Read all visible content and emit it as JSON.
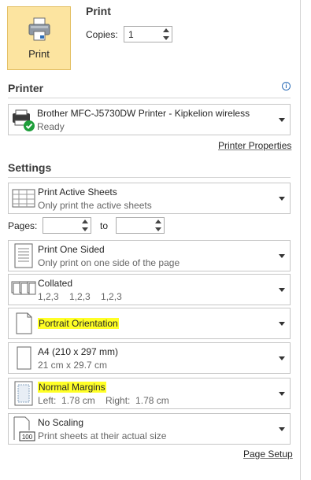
{
  "print_button": {
    "label": "Print"
  },
  "print_section": {
    "heading": "Print",
    "copies_label": "Copies:",
    "copies_value": "1"
  },
  "printer": {
    "heading": "Printer",
    "name": "Brother MFC-J5730DW Printer - Kipkelion wireless",
    "status": "Ready",
    "properties_link": "Printer Properties"
  },
  "settings": {
    "heading": "Settings",
    "pages_label": "Pages:",
    "pages_from": "",
    "to_label": "to",
    "pages_to": "",
    "options": [
      {
        "title": "Print Active Sheets",
        "subtitle": "Only print the active sheets",
        "icon": "sheets-icon"
      },
      {
        "title": "Print One Sided",
        "subtitle": "Only print on one side of the page",
        "icon": "one-sided-icon"
      },
      {
        "title": "Collated",
        "subtitle": "1,2,3    1,2,3    1,2,3",
        "icon": "collated-icon"
      },
      {
        "title": "Portrait Orientation",
        "subtitle": "",
        "icon": "portrait-icon",
        "highlighted": true
      },
      {
        "title": "A4 (210 x 297 mm)",
        "subtitle": "21 cm x 29.7 cm",
        "icon": "paper-size-icon"
      },
      {
        "title": "Normal Margins",
        "subtitle": "Left:  1.78 cm    Right:  1.78 cm",
        "icon": "margins-icon",
        "highlighted": true
      },
      {
        "title": "No Scaling",
        "subtitle": "Print sheets at their actual size",
        "icon": "scaling-icon",
        "badge": "100"
      }
    ],
    "page_setup_link": "Page Setup"
  },
  "colors": {
    "print_button_bg": "#fce4a0",
    "highlight": "#ffff26",
    "status_ok": "#1e9e3a",
    "info": "#2f6fb8"
  }
}
